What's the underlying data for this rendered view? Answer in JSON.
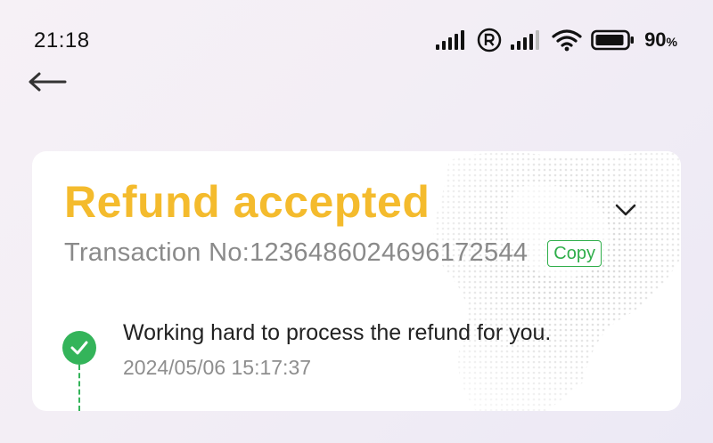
{
  "status_bar": {
    "time": "21:18",
    "battery_percent": "90",
    "battery_unit": "%",
    "icons": [
      "signal-icon",
      "registered-icon",
      "signal-icon",
      "wifi-icon",
      "battery-icon"
    ]
  },
  "nav": {
    "back_icon": "back-arrow-icon"
  },
  "card": {
    "title": "Refund accepted",
    "transaction_label": "Transaction No:1236486024696172544",
    "copy_label": "Copy",
    "expand_icon": "chevron-down-icon",
    "steps": [
      {
        "text": "Working hard to process the refund for you.",
        "time": "2024/05/06 15:17:37",
        "icon": "check-circle-icon"
      }
    ]
  },
  "colors": {
    "title": "#f4bb2d",
    "accent_green": "#34b45a",
    "copy_green": "#2fae4a"
  }
}
